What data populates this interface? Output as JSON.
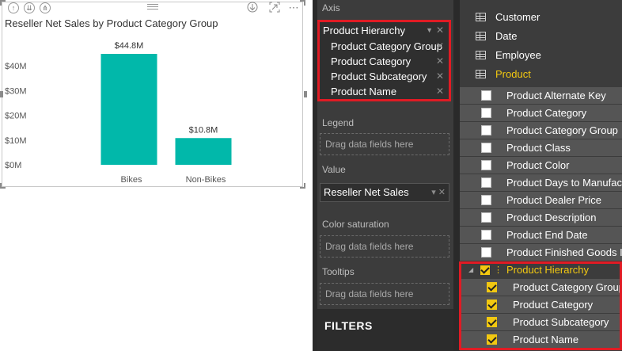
{
  "visual": {
    "title": "Reseller Net Sales by Product Category Group",
    "header_icons": [
      "arrow-up-icon",
      "double-arrow-down-icon",
      "expand-all-icon"
    ],
    "right_icons": [
      "drill-down-icon",
      "focus-mode-icon",
      "more-options-icon"
    ]
  },
  "chart_data": {
    "type": "bar",
    "title": "Reseller Net Sales by Product Category Group",
    "categories": [
      "Bikes",
      "Non-Bikes"
    ],
    "values": [
      44.8,
      10.8
    ],
    "data_labels": [
      "$44.8M",
      "$10.8M"
    ],
    "y_ticks": [
      "$0M",
      "$10M",
      "$20M",
      "$30M",
      "$40M"
    ],
    "y_tick_values": [
      0,
      10,
      20,
      30,
      40
    ],
    "ylim": [
      0,
      44.8
    ],
    "unit": "$M",
    "bar_color": "#01b8aa",
    "grid": false,
    "legend": "none"
  },
  "wells": {
    "axis": {
      "title": "Axis",
      "hierarchy": "Product Hierarchy",
      "levels": [
        "Product Category Group",
        "Product Category",
        "Product Subcategory",
        "Product Name"
      ]
    },
    "legend": {
      "title": "Legend",
      "placeholder": "Drag data fields here"
    },
    "value": {
      "title": "Value",
      "field": "Reseller Net Sales"
    },
    "color_saturation": {
      "title": "Color saturation",
      "placeholder": "Drag data fields here"
    },
    "tooltips": {
      "title": "Tooltips",
      "placeholder": "Drag data fields here"
    },
    "filters": {
      "title": "FILTERS"
    }
  },
  "fields": {
    "tables": [
      {
        "name": "Customer",
        "active": false
      },
      {
        "name": "Date",
        "active": false
      },
      {
        "name": "Employee",
        "active": false
      },
      {
        "name": "Product",
        "active": true
      }
    ],
    "product_fields": [
      "Product Alternate Key",
      "Product Category",
      "Product Category Group",
      "Product Class",
      "Product Color",
      "Product Days to Manufacture",
      "Product Dealer Price",
      "Product Description",
      "Product End Date",
      "Product Finished Goods Indicator"
    ],
    "hierarchy": {
      "name": "Product Hierarchy",
      "levels": [
        "Product Category Group",
        "Product Category",
        "Product Subcategory",
        "Product Name"
      ]
    }
  },
  "colors": {
    "accent": "#f2c811",
    "highlight_border": "#e01b24",
    "bar": "#01b8aa",
    "pane_bg": "#3c3c3c"
  }
}
